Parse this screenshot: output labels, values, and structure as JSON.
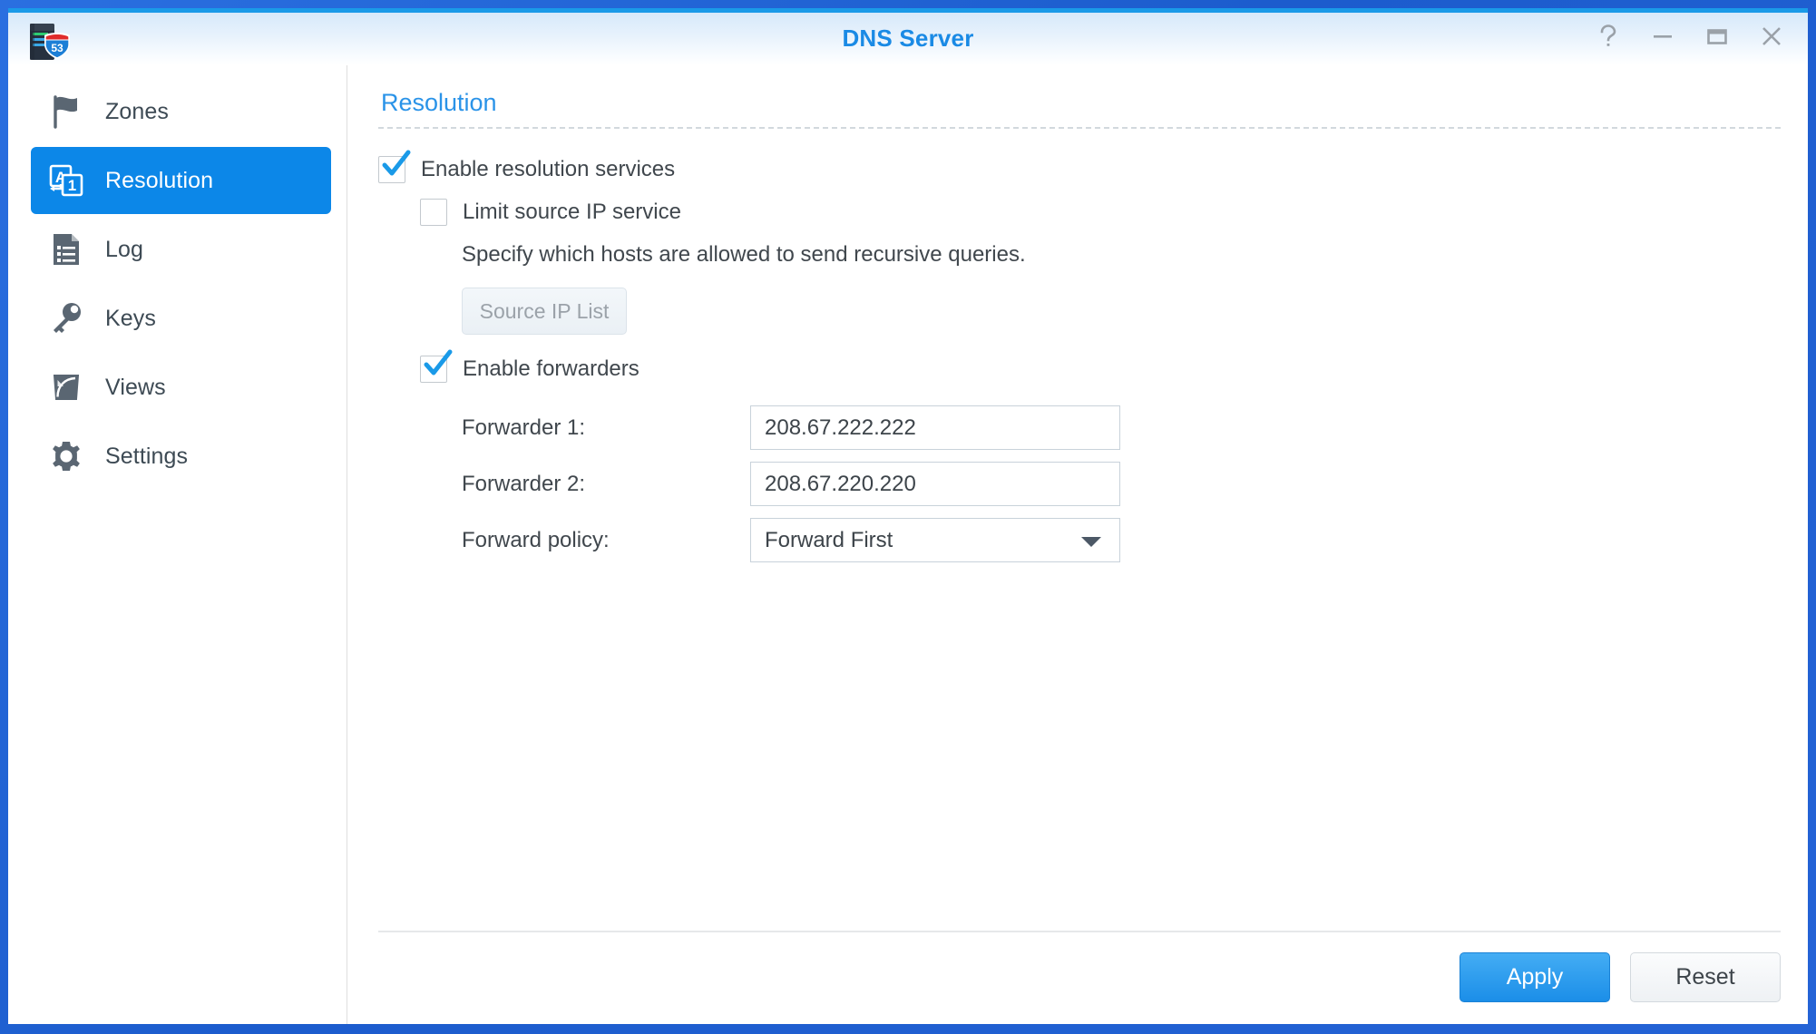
{
  "window": {
    "title": "DNS Server",
    "app_icon": "dns-server-icon",
    "controls": [
      {
        "name": "help-button",
        "glyph": "?"
      },
      {
        "name": "minimize-button",
        "glyph": "−"
      },
      {
        "name": "maximize-button",
        "glyph": "□"
      },
      {
        "name": "close-button",
        "glyph": "✕"
      }
    ]
  },
  "sidebar": {
    "items": [
      {
        "label": "Zones",
        "icon": "flag-icon",
        "active": false
      },
      {
        "label": "Resolution",
        "icon": "translate-a1-icon",
        "active": true
      },
      {
        "label": "Log",
        "icon": "document-list-icon",
        "active": false
      },
      {
        "label": "Keys",
        "icon": "key-icon",
        "active": false
      },
      {
        "label": "Views",
        "icon": "views-icon",
        "active": false
      },
      {
        "label": "Settings",
        "icon": "gear-icon",
        "active": false
      }
    ]
  },
  "main": {
    "section_title": "Resolution",
    "enable_resolution": {
      "label": "Enable resolution services",
      "checked": true
    },
    "limit_source_ip": {
      "label": "Limit source IP service",
      "checked": false
    },
    "source_ip_description": "Specify which hosts are allowed to send recursive queries.",
    "source_ip_list_button": "Source IP List",
    "enable_forwarders": {
      "label": "Enable forwarders",
      "checked": true
    },
    "fields": [
      {
        "label": "Forwarder 1:",
        "value": "208.67.222.222",
        "type": "text"
      },
      {
        "label": "Forwarder 2:",
        "value": "208.67.220.220",
        "type": "text"
      },
      {
        "label": "Forward policy:",
        "value": "Forward First",
        "type": "select"
      }
    ],
    "forward_policy_selected": "Forward First"
  },
  "footer": {
    "apply_label": "Apply",
    "reset_label": "Reset"
  },
  "colors": {
    "accent_blue": "#0c87e8",
    "title_blue": "#1a8ae5",
    "heading_blue": "#2a93e8",
    "frame_blue": "#1a5fd0",
    "icon_gray": "#5a6672",
    "text_dark": "#40474d"
  }
}
